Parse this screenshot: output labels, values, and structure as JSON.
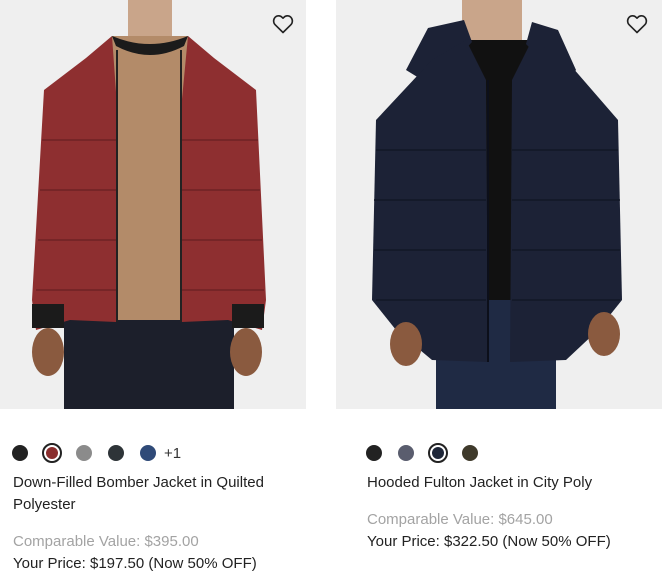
{
  "products": [
    {
      "title": "Down-Filled Bomber Jacket in Quilted Polyester",
      "comparable_value": "Comparable Value: $395.00",
      "your_price": "Your Price: $197.50 (Now 50% OFF)",
      "more_colors": "+1",
      "swatches": [
        "#222222",
        "#8a2e2e",
        "#8b8b8b",
        "#2e3438",
        "#2f4a78"
      ],
      "selected_swatch": 1,
      "jacket_color": "#8e2f30",
      "wishlist_icon": "heart-outline-icon"
    },
    {
      "title": "Hooded Fulton Jacket in City Poly",
      "comparable_value": "Comparable Value: $645.00",
      "your_price": "Your Price: $322.50 (Now 50% OFF)",
      "swatches": [
        "#222222",
        "#5a5d6e",
        "#1e2638",
        "#3f3a2b"
      ],
      "selected_swatch": 2,
      "jacket_color": "#1c2236",
      "wishlist_icon": "heart-outline-icon"
    }
  ]
}
